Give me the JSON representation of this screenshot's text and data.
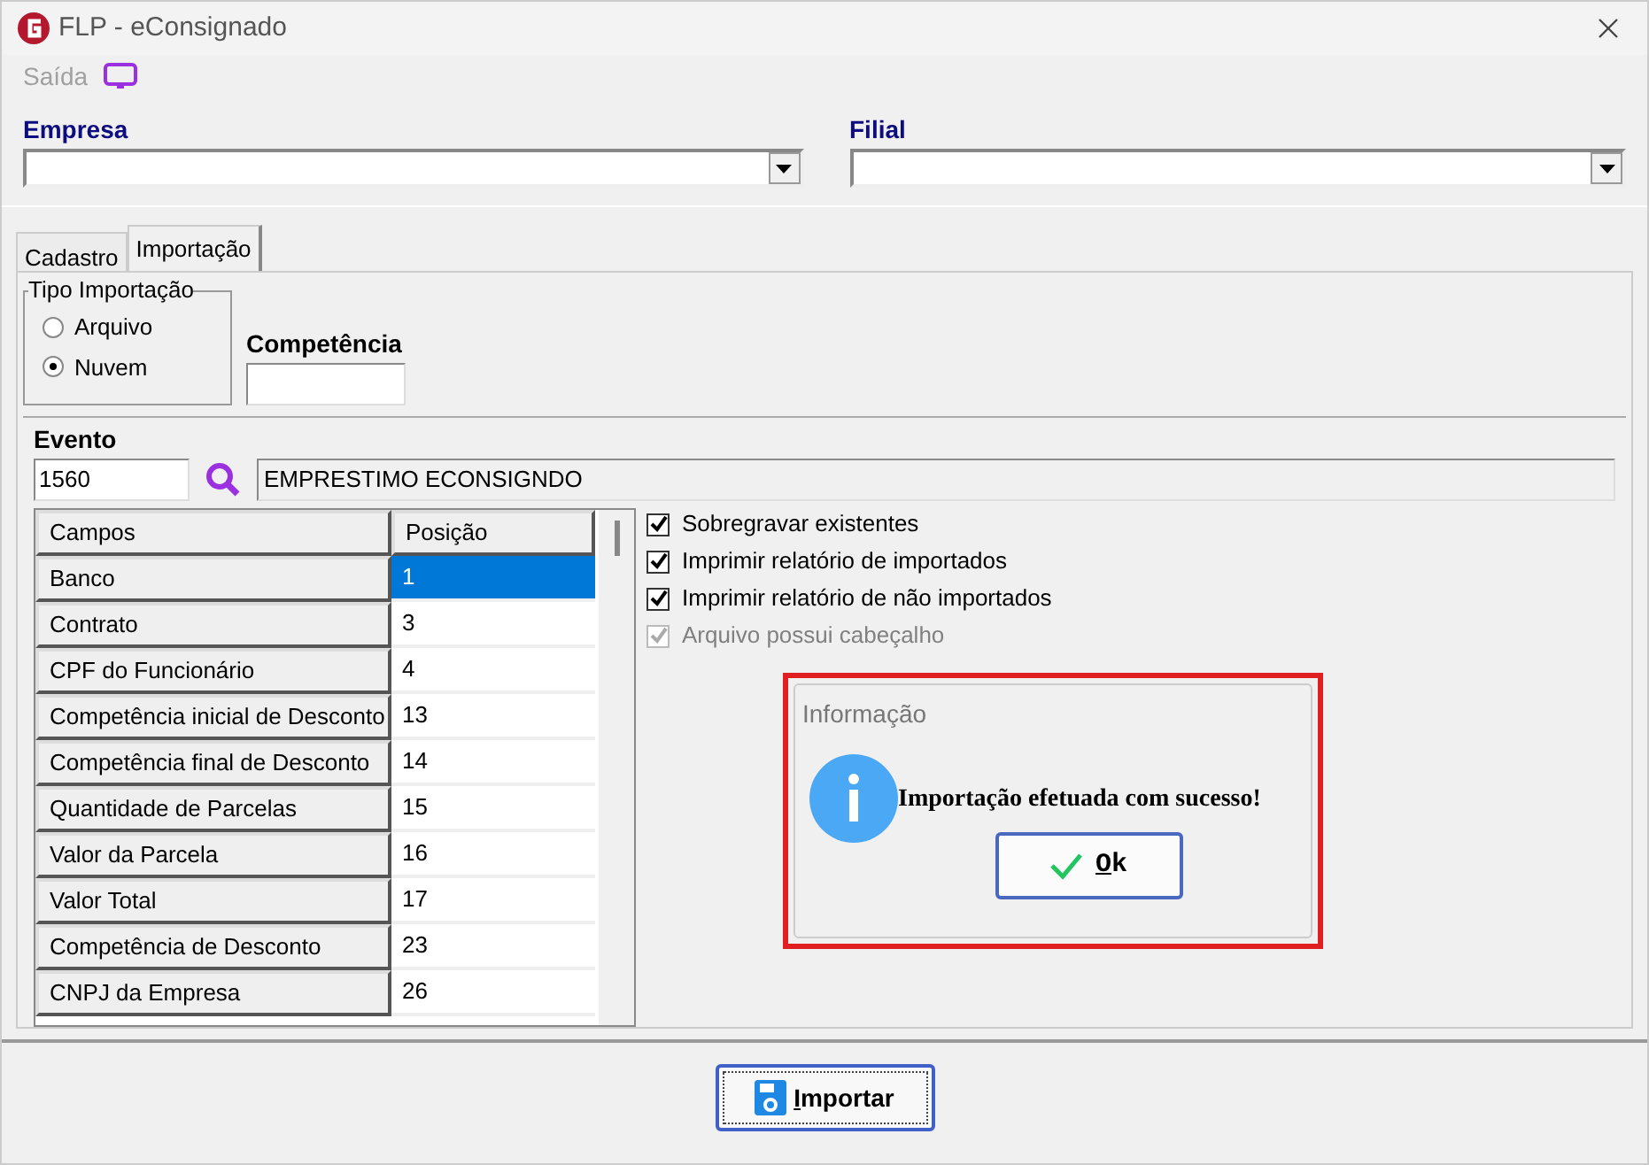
{
  "window": {
    "title": "FLP - eConsignado"
  },
  "menu": {
    "label": "Saída"
  },
  "empresa": {
    "label": "Empresa"
  },
  "filial": {
    "label": "Filial"
  },
  "tabs": [
    {
      "label": "Cadastro",
      "selected": false
    },
    {
      "label": "Importação",
      "selected": true
    }
  ],
  "tipo_importacao": {
    "title": "Tipo Importação",
    "options": [
      {
        "label": "Arquivo",
        "selected": false
      },
      {
        "label": "Nuvem",
        "selected": true
      }
    ]
  },
  "competencia": {
    "label": "Competência"
  },
  "evento": {
    "label": "Evento",
    "code": "1560",
    "description": "EMPRESTIMO ECONSIGNDO"
  },
  "table": {
    "columns": [
      "Campos",
      "Posição"
    ],
    "rows": [
      {
        "campo": "Banco",
        "posicao": "1",
        "selected": true
      },
      {
        "campo": "Contrato",
        "posicao": "3",
        "selected": false
      },
      {
        "campo": "CPF do Funcionário",
        "posicao": "4",
        "selected": false
      },
      {
        "campo": "Competência inicial de Desconto",
        "posicao": "13",
        "selected": false
      },
      {
        "campo": "Competência final de Desconto",
        "posicao": "14",
        "selected": false
      },
      {
        "campo": "Quantidade de Parcelas",
        "posicao": "15",
        "selected": false
      },
      {
        "campo": "Valor da Parcela",
        "posicao": "16",
        "selected": false
      },
      {
        "campo": "Valor Total",
        "posicao": "17",
        "selected": false
      },
      {
        "campo": "Competência de Desconto",
        "posicao": "23",
        "selected": false
      },
      {
        "campo": "CNPJ da Empresa",
        "posicao": "26",
        "selected": false
      }
    ]
  },
  "options": [
    {
      "label": "Sobregravar existentes",
      "checked": true,
      "disabled": false
    },
    {
      "label": "Imprimir relatório de importados",
      "checked": true,
      "disabled": false
    },
    {
      "label": "Imprimir relatório de não importados",
      "checked": true,
      "disabled": false
    },
    {
      "label": "Arquivo possui cabeçalho",
      "checked": true,
      "disabled": true
    }
  ],
  "dialog": {
    "title": "Informação",
    "message": "Importação efetuada com sucesso!",
    "button": "Ok"
  },
  "import_button": "Importar"
}
